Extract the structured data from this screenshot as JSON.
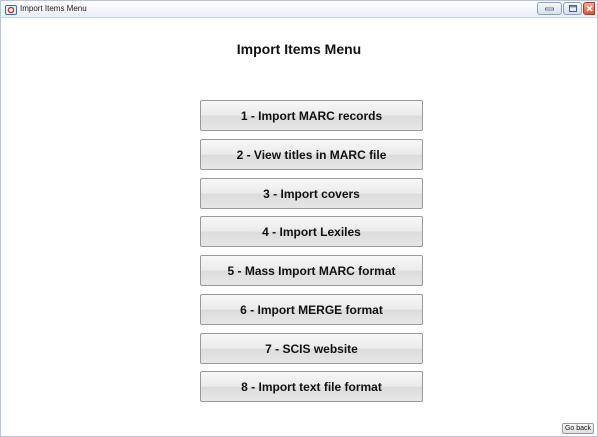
{
  "window": {
    "title": "Import Items Menu"
  },
  "heading": "Import Items Menu",
  "menu_buttons": [
    {
      "label": "1 - Import MARC records"
    },
    {
      "label": "2 - View titles in MARC file"
    },
    {
      "label": "3 - Import covers"
    },
    {
      "label": "4 - Import Lexiles"
    },
    {
      "label": "5 - Mass Import MARC format"
    },
    {
      "label": "6 - Import MERGE format"
    },
    {
      "label": "7 - SCIS website"
    },
    {
      "label": "8 - Import text file format"
    }
  ],
  "go_back_label": "Go back",
  "icons": {
    "app": "app-icon",
    "minimize": "minimize-icon",
    "maximize": "maximize-icon",
    "close": "close-icon"
  },
  "colors": {
    "titlebar": "#e9eef6",
    "button_face": "#ebebeb",
    "close_button": "#d45a3c"
  }
}
